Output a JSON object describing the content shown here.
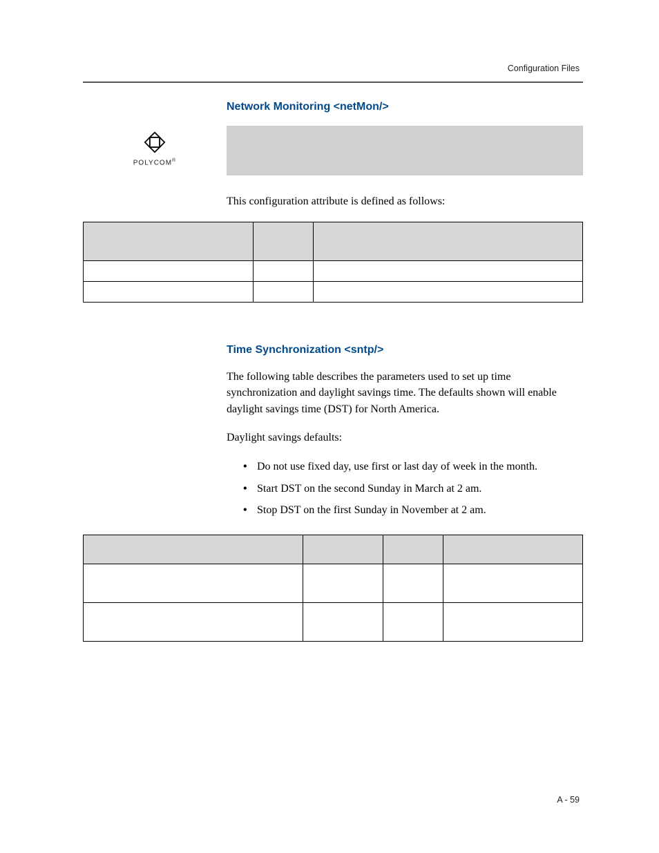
{
  "header": {
    "right": "Configuration Files"
  },
  "section1": {
    "title": "Network Monitoring <netMon/>"
  },
  "logo": {
    "text": "POLYCOM"
  },
  "intro1": "This configuration attribute is defined as follows:",
  "section2": {
    "title": "Time Synchronization <sntp/>",
    "p1": "The following table describes the parameters used to set up time synchronization and daylight savings time. The defaults shown will enable daylight savings time (DST) for North America.",
    "p2": "Daylight savings defaults:",
    "bullets": [
      "Do not use fixed day, use first or last day of week in the month.",
      "Start DST on the second Sunday in March at 2 am.",
      "Stop DST on the first Sunday in November at 2 am."
    ]
  },
  "footer": {
    "page": "A - 59"
  }
}
